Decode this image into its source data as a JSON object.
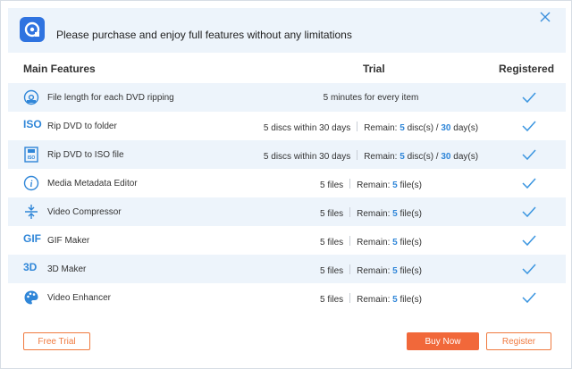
{
  "banner": {
    "text": "Please purchase and enjoy full features without any limitations"
  },
  "header": {
    "features": "Main Features",
    "trial": "Trial",
    "registered": "Registered"
  },
  "rows": [
    {
      "icon": "dvd-disc-icon",
      "name": "File length for each DVD ripping",
      "trial_text": "5 minutes for every item"
    },
    {
      "icon": "iso-icon",
      "icon_text": "ISO",
      "name": "Rip DVD to folder",
      "trial_text": "5 discs within 30 days",
      "remain_label": "Remain:",
      "remain_a": "5",
      "remain_a_unit": "disc(s) /",
      "remain_b": "30",
      "remain_b_unit": "day(s)"
    },
    {
      "icon": "iso-file-icon",
      "name": "Rip DVD to ISO file",
      "trial_text": "5 discs within 30 days",
      "remain_label": "Remain:",
      "remain_a": "5",
      "remain_a_unit": "disc(s) /",
      "remain_b": "30",
      "remain_b_unit": "day(s)"
    },
    {
      "icon": "info-icon",
      "name": "Media Metadata Editor",
      "trial_text": "5 files",
      "remain_label": "Remain:",
      "remain_a": "5",
      "remain_a_unit": "file(s)"
    },
    {
      "icon": "compress-icon",
      "name": "Video Compressor",
      "trial_text": "5 files",
      "remain_label": "Remain:",
      "remain_a": "5",
      "remain_a_unit": "file(s)"
    },
    {
      "icon": "gif-icon",
      "icon_text": "GIF",
      "name": "GIF Maker",
      "trial_text": "5 files",
      "remain_label": "Remain:",
      "remain_a": "5",
      "remain_a_unit": "file(s)"
    },
    {
      "icon": "3d-icon",
      "icon_text": "3D",
      "name": "3D Maker",
      "trial_text": "5 files",
      "remain_label": "Remain:",
      "remain_a": "5",
      "remain_a_unit": "file(s)"
    },
    {
      "icon": "palette-icon",
      "name": "Video Enhancer",
      "trial_text": "5 files",
      "remain_label": "Remain:",
      "remain_a": "5",
      "remain_a_unit": "file(s)"
    }
  ],
  "buttons": {
    "free_trial": "Free Trial",
    "buy_now": "Buy Now",
    "register": "Register"
  },
  "colors": {
    "accent": "#2f86d8",
    "orange": "#f1683a",
    "row_alt": "#edf4fb"
  }
}
